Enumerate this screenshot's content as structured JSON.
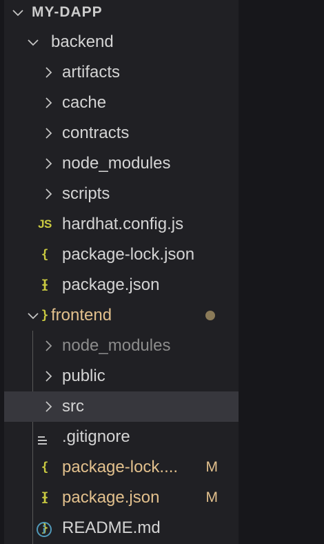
{
  "explorer": {
    "root": {
      "label": "MY-DAPP",
      "expanded": true
    },
    "backend": {
      "label": "backend",
      "children": [
        {
          "label": "artifacts",
          "type": "folder",
          "icon": "chevron-right-icon"
        },
        {
          "label": "cache",
          "type": "folder",
          "icon": "chevron-right-icon"
        },
        {
          "label": "contracts",
          "type": "folder",
          "icon": "chevron-right-icon"
        },
        {
          "label": "node_modules",
          "type": "folder",
          "icon": "chevron-right-icon"
        },
        {
          "label": "scripts",
          "type": "folder",
          "icon": "chevron-right-icon"
        },
        {
          "label": "hardhat.config.js",
          "type": "file",
          "icon": "js-file-icon",
          "icon_text": "JS"
        },
        {
          "label": "package-lock.json",
          "type": "file",
          "icon": "json-file-icon",
          "icon_text": "{ }"
        },
        {
          "label": "package.json",
          "type": "file",
          "icon": "json-file-icon",
          "icon_text": "{ }"
        }
      ]
    },
    "frontend": {
      "label": "frontend",
      "has_modified_indicator": true,
      "children": [
        {
          "label": "node_modules",
          "type": "folder",
          "icon": "chevron-right-icon",
          "dimmed": true
        },
        {
          "label": "public",
          "type": "folder",
          "icon": "chevron-right-icon"
        },
        {
          "label": "src",
          "type": "folder",
          "icon": "chevron-right-icon",
          "selected": true
        },
        {
          "label": ".gitignore",
          "type": "file",
          "icon": "lines-file-icon"
        },
        {
          "label": "package-lock....",
          "type": "file",
          "icon": "json-file-icon",
          "icon_text": "{ }",
          "status": "M"
        },
        {
          "label": "package.json",
          "type": "file",
          "icon": "json-file-icon",
          "icon_text": "{ }",
          "status": "M"
        },
        {
          "label": "README.md",
          "type": "file",
          "icon": "info-icon"
        }
      ]
    }
  },
  "colors": {
    "background": "#202024",
    "text": "#d4d4d4",
    "modified": "#e2c08d",
    "json_icon": "#cbcb41",
    "info_icon": "#519aba",
    "selection": "#37373d"
  }
}
